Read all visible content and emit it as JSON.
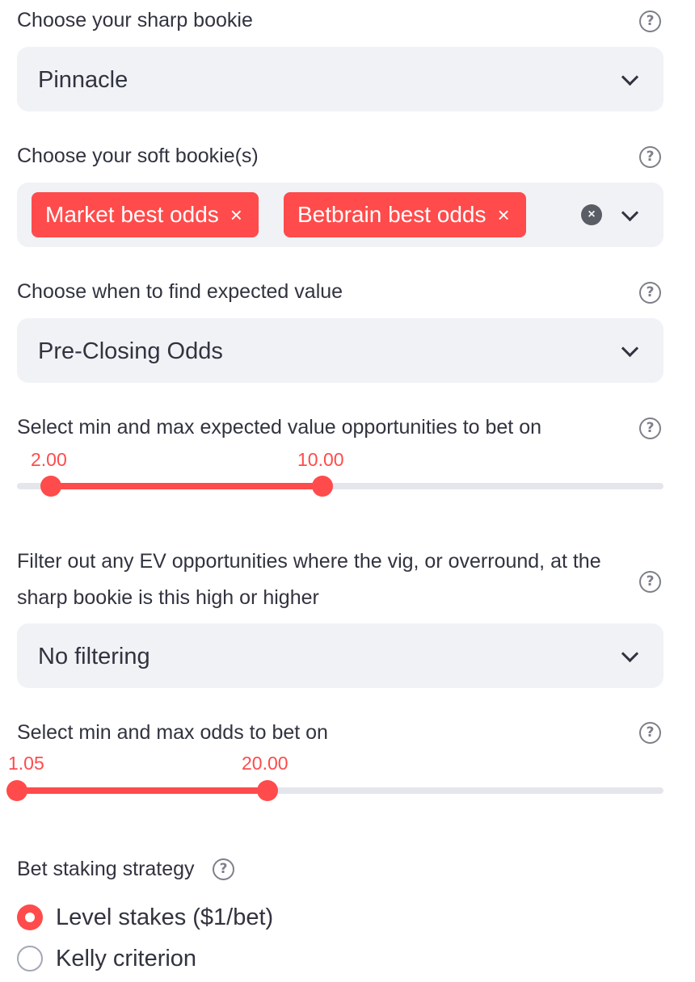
{
  "help_glyph": "?",
  "sharp_bookie": {
    "label": "Choose your sharp bookie",
    "value": "Pinnacle"
  },
  "soft_bookies": {
    "label": "Choose your soft bookie(s)",
    "tags": [
      "Market best odds",
      "Betbrain best odds"
    ],
    "remove_glyph": "×",
    "clear_glyph": "×"
  },
  "ev_timing": {
    "label": "Choose when to find expected value",
    "value": "Pre-Closing Odds"
  },
  "ev_range": {
    "label": "Select min and max expected value opportunities to bet on",
    "min_label": "2.00",
    "max_label": "10.00",
    "min": 2.0,
    "max": 10.0
  },
  "vig_filter": {
    "label_line1": "Filter out any EV opportunities where the vig, or overround, at the",
    "label_line2": "sharp bookie is this high or higher",
    "value": "No filtering"
  },
  "odds_range": {
    "label": "Select min and max odds to bet on",
    "min_label": "1.05",
    "max_label": "20.00",
    "min": 1.05,
    "max": 20.0
  },
  "staking": {
    "label": "Bet staking strategy",
    "options": [
      "Level stakes ($1/bet)",
      "Kelly criterion"
    ],
    "selected": "Level stakes ($1/bet)"
  },
  "colors": {
    "accent": "#ff4b4b",
    "field_bg": "#f0f2f6",
    "text": "#31333f",
    "track": "#e4e6ec"
  },
  "icons": {
    "help": "question-circle-icon",
    "dropdown": "chevron-down-icon",
    "remove": "close-icon",
    "clear": "clear-circle-icon"
  }
}
